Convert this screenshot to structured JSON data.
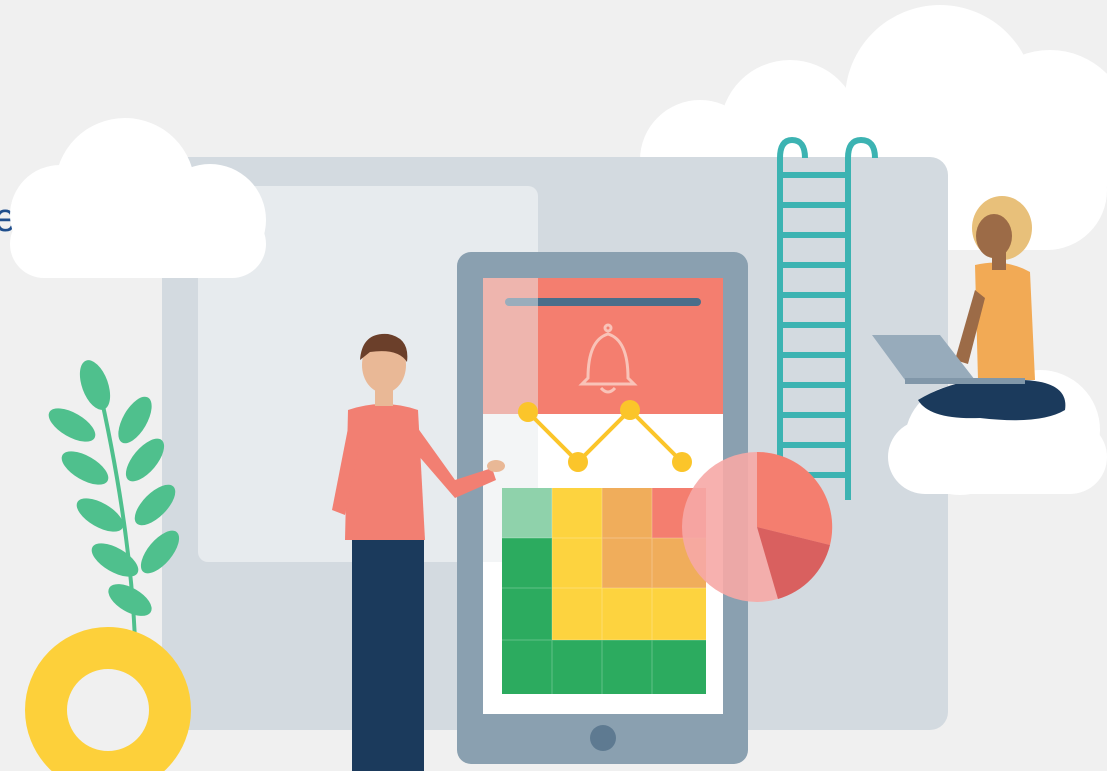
{
  "illustration": {
    "theme": "mobile data analytics",
    "clipped_edge_text": "e",
    "colors": {
      "background": "#f0f0f0",
      "panel": "#d3dae0",
      "tablet_body": "#8aa0b0",
      "header_red": "#f47e6f",
      "heatmap_green": "#2cab5f",
      "heatmap_yellow": "#fdd33f",
      "heatmap_orange": "#f0ad5b",
      "line_marker": "#fbc52a",
      "ladder": "#3cb3b2",
      "shirt": "#f27f72",
      "trousers": "#1b3a5c",
      "donut": "#fdd03a"
    },
    "icons": [
      "bell-icon",
      "pie-chart-icon",
      "line-chart-icon",
      "heatmap-icon",
      "ladder-icon",
      "cloud-icon",
      "plant-icon",
      "donut-shape"
    ]
  }
}
